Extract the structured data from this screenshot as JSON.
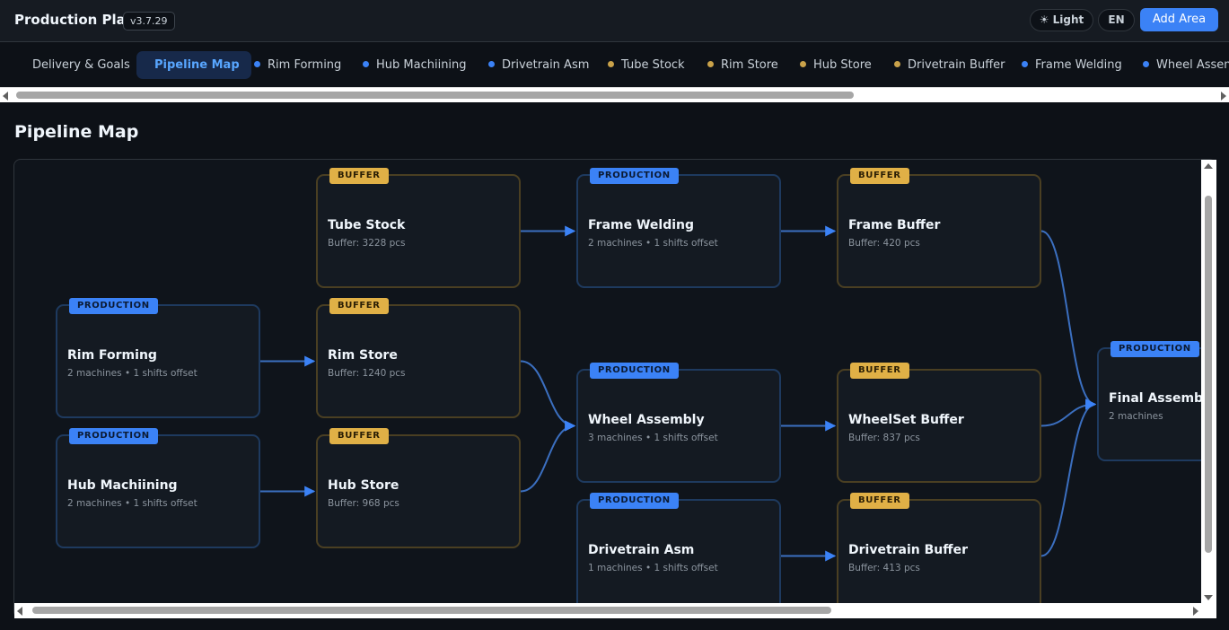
{
  "header": {
    "title": "Production Plan",
    "version": "v3.7.29",
    "theme_toggle": "☀ Light",
    "language": "EN",
    "add_area": "Add Area"
  },
  "tabs": [
    {
      "label": "Delivery & Goals",
      "dot": ""
    },
    {
      "label": "Pipeline Map",
      "dot": "",
      "active": true
    },
    {
      "label": "Rim Forming",
      "dot": "#3b82f6"
    },
    {
      "label": "Hub Machiining",
      "dot": "#3b82f6"
    },
    {
      "label": "Drivetrain Asm",
      "dot": "#3b82f6"
    },
    {
      "label": "Tube Stock",
      "dot": "#c9a24a"
    },
    {
      "label": "Rim Store",
      "dot": "#c9a24a"
    },
    {
      "label": "Hub Store",
      "dot": "#c9a24a"
    },
    {
      "label": "Drivetrain Buffer",
      "dot": "#c9a24a"
    },
    {
      "label": "Frame Welding",
      "dot": "#3b82f6"
    },
    {
      "label": "Wheel Assembly",
      "dot": "#3b82f6"
    }
  ],
  "page_title": "Pipeline Map",
  "nodes": [
    {
      "id": "tube-stock",
      "type": "buffer",
      "badge": "BUFFER",
      "name": "Tube Stock",
      "meta": "Buffer: 3228 pcs"
    },
    {
      "id": "frame-welding",
      "type": "production",
      "badge": "PRODUCTION",
      "name": "Frame Welding",
      "meta": "2 machines • 1 shifts offset"
    },
    {
      "id": "frame-buffer",
      "type": "buffer",
      "badge": "BUFFER",
      "name": "Frame Buffer",
      "meta": "Buffer: 420 pcs"
    },
    {
      "id": "rim-forming",
      "type": "production",
      "badge": "PRODUCTION",
      "name": "Rim Forming",
      "meta": "2 machines • 1 shifts offset"
    },
    {
      "id": "rim-store",
      "type": "buffer",
      "badge": "BUFFER",
      "name": "Rim Store",
      "meta": "Buffer: 1240 pcs"
    },
    {
      "id": "wheel-assembly",
      "type": "production",
      "badge": "PRODUCTION",
      "name": "Wheel Assembly",
      "meta": "3 machines • 1 shifts offset"
    },
    {
      "id": "wheelset-buffer",
      "type": "buffer",
      "badge": "BUFFER",
      "name": "WheelSet Buffer",
      "meta": "Buffer: 837 pcs"
    },
    {
      "id": "final-assembly",
      "type": "production",
      "badge": "PRODUCTION",
      "name": "Final Assembly",
      "meta": "2 machines"
    },
    {
      "id": "hub-machining",
      "type": "production",
      "badge": "PRODUCTION",
      "name": "Hub Machiining",
      "meta": "2 machines • 1 shifts offset"
    },
    {
      "id": "hub-store",
      "type": "buffer",
      "badge": "BUFFER",
      "name": "Hub Store",
      "meta": "Buffer: 968 pcs"
    },
    {
      "id": "drivetrain-asm",
      "type": "production",
      "badge": "PRODUCTION",
      "name": "Drivetrain Asm",
      "meta": "1 machines • 1 shifts offset"
    },
    {
      "id": "drivetrain-buffer",
      "type": "buffer",
      "badge": "BUFFER",
      "name": "Drivetrain Buffer",
      "meta": "Buffer: 413 pcs"
    }
  ],
  "edges": [
    [
      "tube-stock",
      "frame-welding"
    ],
    [
      "frame-welding",
      "frame-buffer"
    ],
    [
      "rim-forming",
      "rim-store"
    ],
    [
      "hub-machining",
      "hub-store"
    ],
    [
      "rim-store",
      "wheel-assembly"
    ],
    [
      "hub-store",
      "wheel-assembly"
    ],
    [
      "wheel-assembly",
      "wheelset-buffer"
    ],
    [
      "drivetrain-asm",
      "drivetrain-buffer"
    ],
    [
      "frame-buffer",
      "final-assembly"
    ],
    [
      "wheelset-buffer",
      "final-assembly"
    ],
    [
      "drivetrain-buffer",
      "final-assembly"
    ]
  ],
  "colors": {
    "production": "#3b82f6",
    "buffer": "#e0b046",
    "edge": "#3b6fc0",
    "accent": "#3b82f6"
  }
}
